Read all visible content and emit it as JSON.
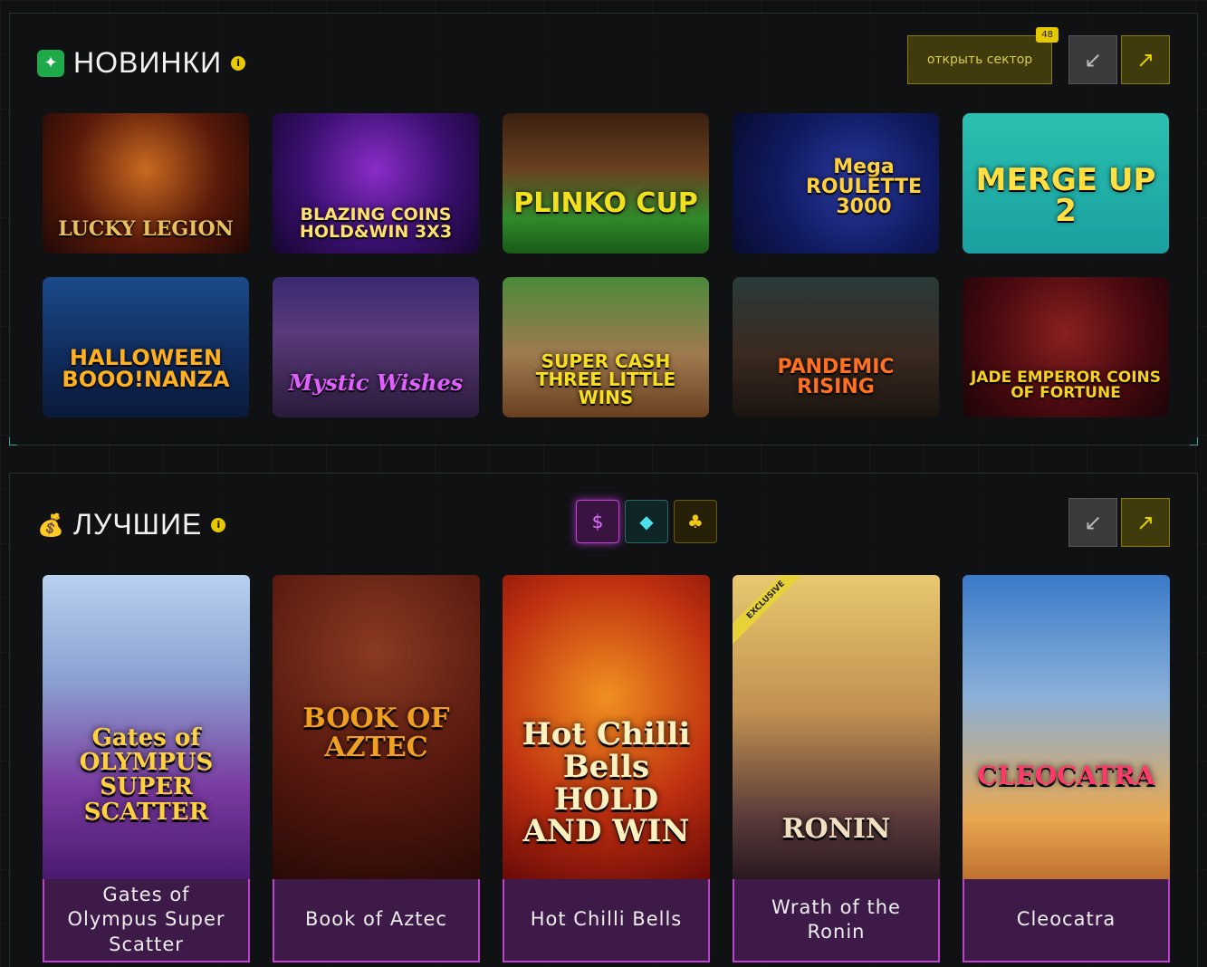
{
  "sections": {
    "new": {
      "title": "НОВИНКИ",
      "info": "i",
      "open_sector_label": "открыть сектор",
      "count": "48",
      "prev_icon": "↙",
      "next_icon": "↗",
      "icon": "✦",
      "games": [
        {
          "title": "LUCKY LEGION"
        },
        {
          "title": "BLAZING COINS HOLD&WIN 3X3"
        },
        {
          "title": "PLINKO CUP"
        },
        {
          "title": "Mega ROULETTE 3000"
        },
        {
          "title": "MERGE UP 2"
        },
        {
          "title": "HALLOWEEN BOOO!NANZA"
        },
        {
          "title": "Mystic Wishes"
        },
        {
          "title": "SUPER CASH THREE LITTLE WINS"
        },
        {
          "title": "PANDEMIC RISING"
        },
        {
          "title": "JADE EMPEROR COINS OF FORTUNE"
        }
      ]
    },
    "best": {
      "title": "ЛУЧШИЕ",
      "info": "i",
      "icon": "💰",
      "prev_icon": "↙",
      "next_icon": "↗",
      "filters": [
        {
          "icon": "money-bag-icon",
          "glyph": "$"
        },
        {
          "icon": "diamond-icon",
          "glyph": "◆"
        },
        {
          "icon": "casino-chip-icon",
          "glyph": "♣"
        }
      ],
      "games": [
        {
          "label": "Gates of Olympus Super Scatter",
          "art_title": "Gates of OLYMPUS SUPER SCATTER"
        },
        {
          "label": "Book of Aztec",
          "art_title": "BOOK OF AZTEC"
        },
        {
          "label": "Hot Chilli Bells",
          "art_title": "Hot Chilli Bells HOLD AND WIN"
        },
        {
          "label": "Wrath of the Ronin",
          "art_title": "RONIN",
          "badge": "EXCLUSIVE"
        },
        {
          "label": "Cleocatra",
          "art_title": "CLEOCATRA"
        }
      ]
    }
  }
}
